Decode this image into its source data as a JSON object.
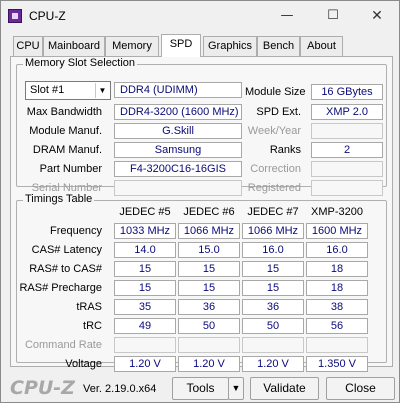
{
  "window": {
    "title": "CPU-Z",
    "minimize": "—",
    "maximize": "☐",
    "close": "✕"
  },
  "tabs": [
    "CPU",
    "Mainboard",
    "Memory",
    "SPD",
    "Graphics",
    "Bench",
    "About"
  ],
  "active_tab": "SPD",
  "slot": {
    "group_title": "Memory Slot Selection",
    "selected": "Slot #1",
    "type": "DDR4 (UDIMM)",
    "max_bandwidth_label": "Max Bandwidth",
    "max_bandwidth": "DDR4-3200 (1600 MHz)",
    "module_manuf_label": "Module Manuf.",
    "module_manuf": "G.Skill",
    "dram_manuf_label": "DRAM Manuf.",
    "dram_manuf": "Samsung",
    "part_number_label": "Part Number",
    "part_number": "F4-3200C16-16GIS",
    "serial_number_label": "Serial Number",
    "serial_number": "",
    "module_size_label": "Module Size",
    "module_size": "16 GBytes",
    "spd_ext_label": "SPD Ext.",
    "spd_ext": "XMP 2.0",
    "week_year_label": "Week/Year",
    "week_year": "",
    "ranks_label": "Ranks",
    "ranks": "2",
    "correction_label": "Correction",
    "correction": "",
    "registered_label": "Registered",
    "registered": ""
  },
  "timings": {
    "group_title": "Timings Table",
    "columns": [
      "JEDEC #5",
      "JEDEC #6",
      "JEDEC #7",
      "XMP-3200"
    ],
    "rows": [
      {
        "label": "Frequency",
        "values": [
          "1033 MHz",
          "1066 MHz",
          "1066 MHz",
          "1600 MHz"
        ]
      },
      {
        "label": "CAS# Latency",
        "values": [
          "14.0",
          "15.0",
          "16.0",
          "16.0"
        ]
      },
      {
        "label": "RAS# to CAS#",
        "values": [
          "15",
          "15",
          "15",
          "18"
        ]
      },
      {
        "label": "RAS# Precharge",
        "values": [
          "15",
          "15",
          "15",
          "18"
        ]
      },
      {
        "label": "tRAS",
        "values": [
          "35",
          "36",
          "36",
          "38"
        ]
      },
      {
        "label": "tRC",
        "values": [
          "49",
          "50",
          "50",
          "56"
        ]
      },
      {
        "label": "Command Rate",
        "values": [
          "",
          "",
          "",
          ""
        ]
      },
      {
        "label": "Voltage",
        "values": [
          "1.20 V",
          "1.20 V",
          "1.20 V",
          "1.350 V"
        ]
      }
    ]
  },
  "footer": {
    "brand": "CPU-Z",
    "version": "Ver. 2.19.0.x64",
    "tools": "Tools",
    "tools_arrow": "▼",
    "validate": "Validate",
    "close": "Close"
  }
}
